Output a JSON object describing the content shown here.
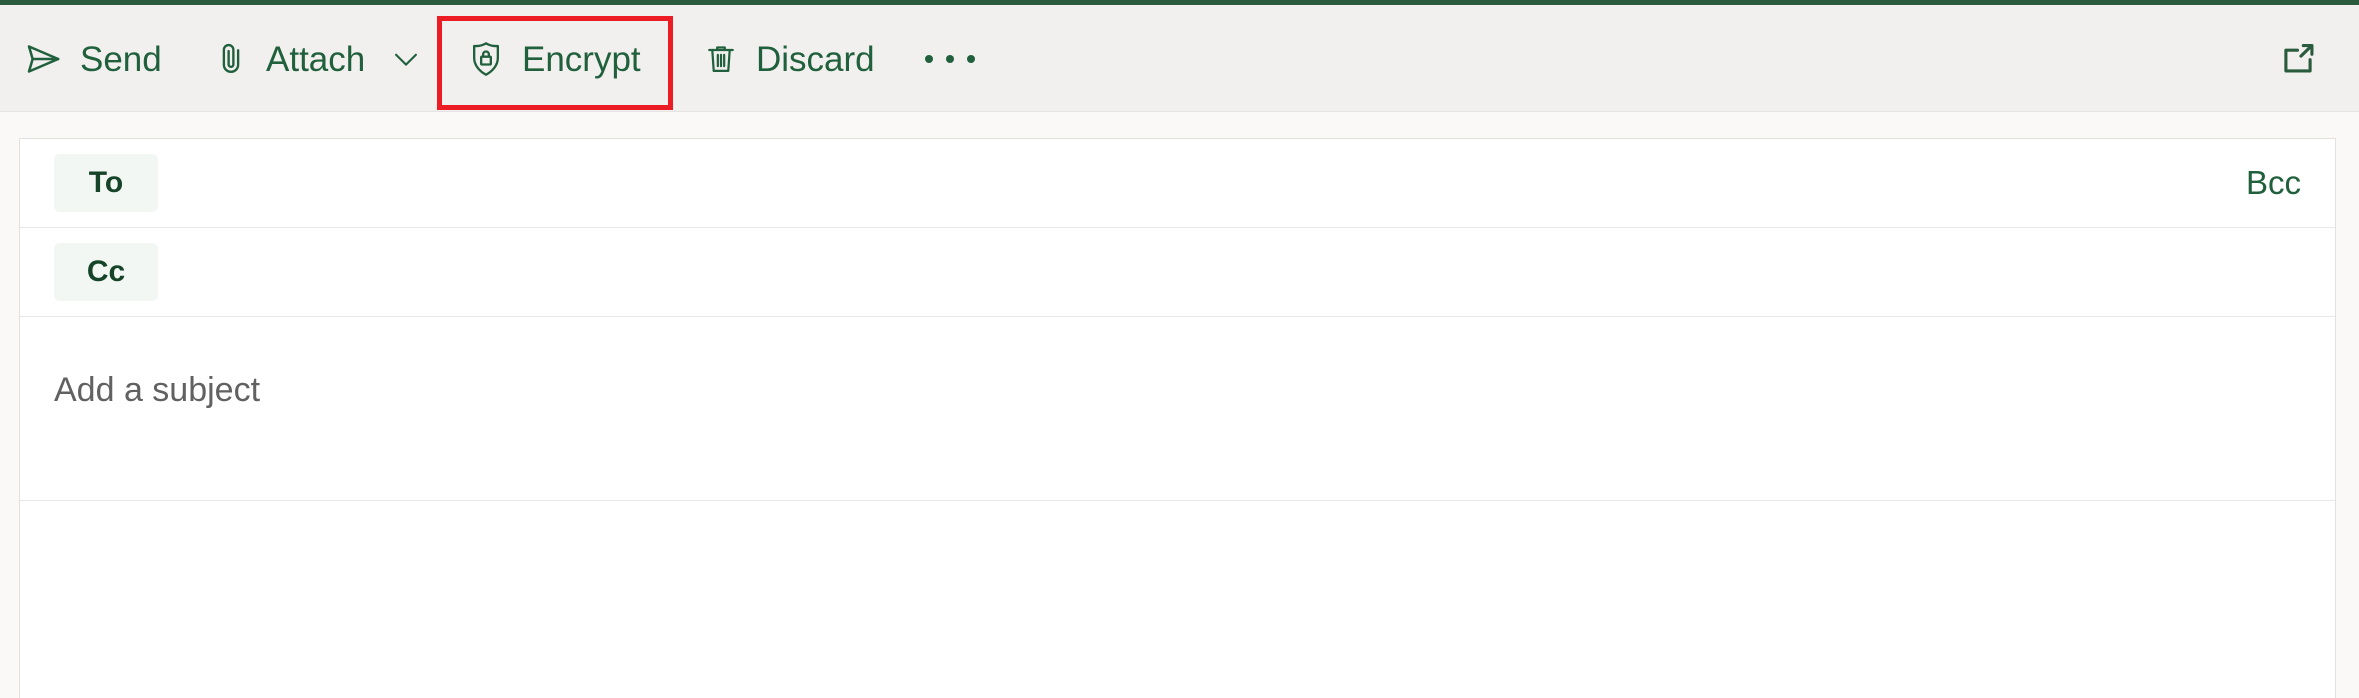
{
  "theme": {
    "accent_green": "#2a5b3c",
    "command_text_green": "#21603c",
    "chip_bg": "#f2f7f3",
    "chip_text": "#164428",
    "toolbar_bg": "#f1f0ee",
    "page_bg": "#faf9f8",
    "card_bg": "#ffffff",
    "highlight_red": "#ec1c24",
    "divider": "#e9e8e6"
  },
  "toolbar": {
    "send": {
      "label": "Send",
      "icon": "send-icon"
    },
    "attach": {
      "label": "Attach",
      "icon": "paperclip-icon",
      "chevron": "chevron-down-icon"
    },
    "encrypt": {
      "label": "Encrypt",
      "icon": "shield-lock-icon",
      "highlighted": true
    },
    "discard": {
      "label": "Discard",
      "icon": "trash-icon"
    },
    "more": {
      "label": "More options",
      "icon": "ellipsis-icon"
    },
    "popout": {
      "label": "Open in separate window",
      "icon": "popout-icon"
    }
  },
  "compose": {
    "to": {
      "chip_label": "To",
      "value": "",
      "placeholder": ""
    },
    "bcc_label": "Bcc",
    "cc": {
      "chip_label": "Cc",
      "value": "",
      "placeholder": ""
    },
    "subject": {
      "value": "",
      "placeholder": "Add a subject"
    },
    "body": {
      "value": "",
      "placeholder": ""
    }
  }
}
